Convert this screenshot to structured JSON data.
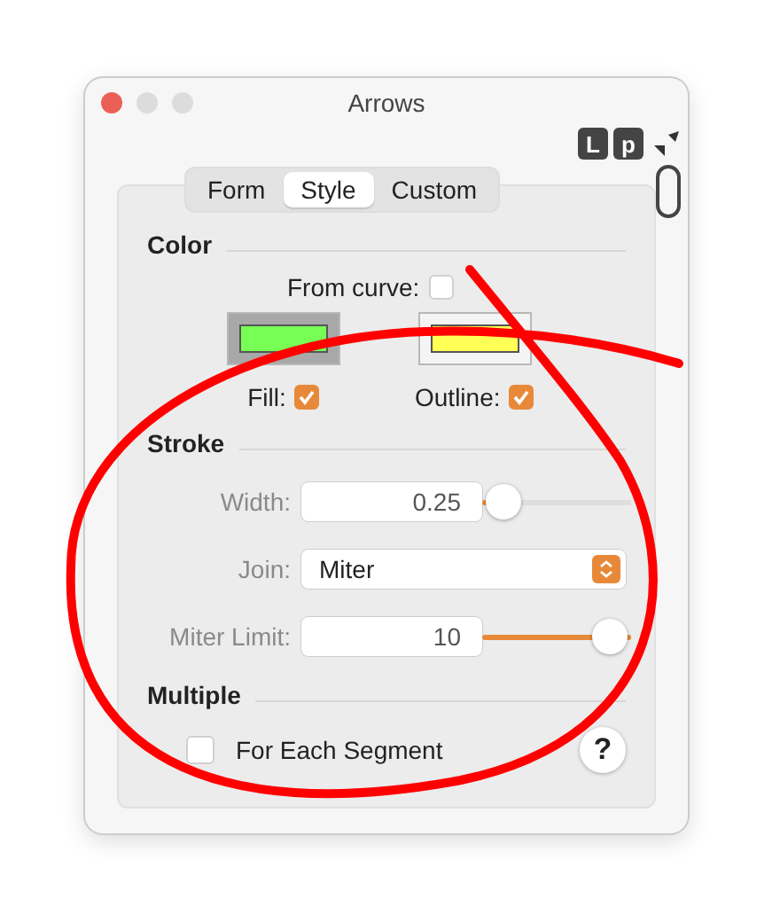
{
  "window": {
    "title": "Arrows"
  },
  "toolbar": {
    "badges": [
      "L",
      "p"
    ]
  },
  "tabs": [
    {
      "label": "Form",
      "selected": false
    },
    {
      "label": "Style",
      "selected": true
    },
    {
      "label": "Custom",
      "selected": false
    }
  ],
  "color": {
    "heading": "Color",
    "from_curve": {
      "label": "From curve:",
      "checked": false
    },
    "swatches": [
      {
        "label": "Fill:",
        "color": "#77ff55",
        "checked": true,
        "selected": true
      },
      {
        "label": "Outline:",
        "color": "#ffff55",
        "checked": true,
        "selected": false
      }
    ]
  },
  "stroke": {
    "heading": "Stroke",
    "width": {
      "label": "Width:",
      "value": "0.25",
      "level": 0.03
    },
    "join": {
      "label": "Join:",
      "value": "Miter"
    },
    "miter_limit": {
      "label": "Miter Limit:",
      "value": "10",
      "level": 1
    }
  },
  "multiple": {
    "heading": "Multiple",
    "for_each_segment": {
      "label": "For Each Segment",
      "checked": false
    }
  },
  "help_button": "?"
}
